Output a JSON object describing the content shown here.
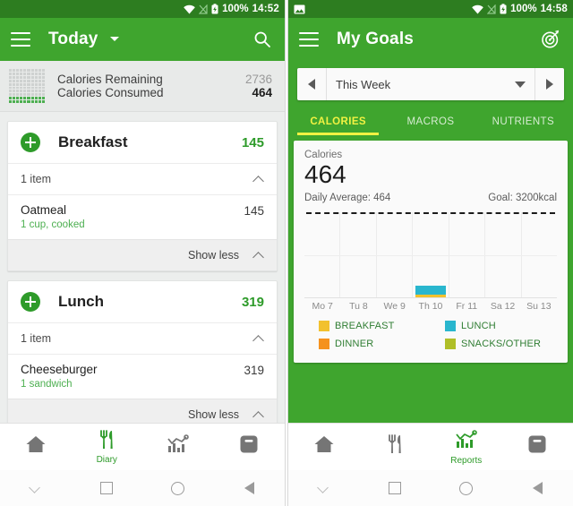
{
  "left": {
    "statusbar": {
      "wifi_icon": "wifi-icon",
      "signal_icon": "signal-off-icon",
      "battery_icon": "battery-charging-icon",
      "battery": "100%",
      "time": "14:52"
    },
    "appbar": {
      "menu_icon": "hamburger-icon",
      "title": "Today",
      "dropdown_icon": "caret-down-icon",
      "action_icon": "search-icon"
    },
    "summary": {
      "progress_icon": "calorie-dot-grid-icon",
      "remaining_label": "Calories Remaining",
      "remaining_value": "2736",
      "consumed_label": "Calories Consumed",
      "consumed_value": "464",
      "progress_percent": 15
    },
    "meals": [
      {
        "add_icon": "plus-circle-icon",
        "name": "Breakfast",
        "calories": "145",
        "item_count": "1 item",
        "collapse_icon": "chevron-up-icon",
        "foods": [
          {
            "name": "Oatmeal",
            "serving": "1  cup, cooked",
            "calories": "145"
          }
        ],
        "show_less_label": "Show less",
        "show_less_icon": "chevron-up-icon"
      },
      {
        "add_icon": "plus-circle-icon",
        "name": "Lunch",
        "calories": "319",
        "item_count": "1 item",
        "collapse_icon": "chevron-up-icon",
        "foods": [
          {
            "name": "Cheeseburger",
            "serving": "1  sandwich",
            "calories": "319"
          }
        ],
        "show_less_label": "Show less",
        "show_less_icon": "chevron-up-icon"
      }
    ],
    "bottomnav": [
      {
        "icon": "home-icon",
        "label": "",
        "active": false
      },
      {
        "icon": "cutlery-icon",
        "label": "Diary",
        "active": true
      },
      {
        "icon": "reports-chart-icon",
        "label": "",
        "active": false
      },
      {
        "icon": "scale-icon",
        "label": "",
        "active": false
      }
    ],
    "navbar": [
      {
        "icon": "collapse-chevron-icon"
      },
      {
        "icon": "recents-square-icon"
      },
      {
        "icon": "home-circle-icon"
      },
      {
        "icon": "back-triangle-icon"
      }
    ]
  },
  "right": {
    "statusbar": {
      "image_icon": "photo-icon",
      "wifi_icon": "wifi-icon",
      "signal_icon": "signal-off-icon",
      "battery_icon": "battery-charging-icon",
      "battery": "100%",
      "time": "14:58"
    },
    "appbar": {
      "menu_icon": "hamburger-icon",
      "title": "My Goals",
      "action_icon": "target-goal-icon"
    },
    "weekselector": {
      "prev_icon": "arrow-left-icon",
      "value": "This Week",
      "dropdown_icon": "caret-down-icon",
      "next_icon": "arrow-right-icon"
    },
    "tabs": [
      {
        "label": "CALORIES",
        "active": true
      },
      {
        "label": "MACROS",
        "active": false
      },
      {
        "label": "NUTRIENTS",
        "active": false
      }
    ],
    "card": {
      "title": "Calories",
      "value": "464",
      "daily_average": "Daily Average: 464",
      "goal": "Goal: 3200kcal"
    },
    "legend": [
      {
        "label": "BREAKFAST",
        "color": "#f2c12e"
      },
      {
        "label": "LUNCH",
        "color": "#29b6ce"
      },
      {
        "label": "DINNER",
        "color": "#f5921e"
      },
      {
        "label": "SNACKS/OTHER",
        "color": "#b0bf28"
      }
    ],
    "bottomnav": [
      {
        "icon": "home-icon",
        "label": "",
        "active": false
      },
      {
        "icon": "cutlery-icon",
        "label": "",
        "active": false
      },
      {
        "icon": "reports-chart-icon",
        "label": "Reports",
        "active": true
      },
      {
        "icon": "scale-icon",
        "label": "",
        "active": false
      }
    ],
    "navbar": [
      {
        "icon": "collapse-chevron-icon"
      },
      {
        "icon": "recents-square-icon"
      },
      {
        "icon": "home-circle-icon"
      },
      {
        "icon": "back-triangle-icon"
      }
    ]
  },
  "chart_data": {
    "type": "bar",
    "title": "Calories",
    "xlabel": "",
    "ylabel": "Calories",
    "categories": [
      "Mo 7",
      "Tu 8",
      "We 9",
      "Th 10",
      "Fr 11",
      "Sa 12",
      "Su 13"
    ],
    "series": [
      {
        "name": "BREAKFAST",
        "color": "#f2c12e",
        "values": [
          0,
          0,
          0,
          145,
          0,
          0,
          0
        ]
      },
      {
        "name": "LUNCH",
        "color": "#29b6ce",
        "values": [
          0,
          0,
          0,
          319,
          0,
          0,
          0
        ]
      },
      {
        "name": "DINNER",
        "color": "#f5921e",
        "values": [
          0,
          0,
          0,
          0,
          0,
          0,
          0
        ]
      },
      {
        "name": "SNACKS/OTHER",
        "color": "#b0bf28",
        "values": [
          0,
          0,
          0,
          0,
          0,
          0,
          0
        ]
      }
    ],
    "stacked": true,
    "goal_line": 3200,
    "goal_line_label": "Goal: 3200kcal",
    "daily_average": 464,
    "total": 464,
    "ylim": [
      0,
      3200
    ],
    "grid": true,
    "legend_position": "bottom"
  },
  "colors": {
    "appbar_green": "#3fa52e",
    "statusbar_green": "#2d7d20",
    "accent_green": "#2e9b2a",
    "tab_active_yellow": "#f2f242"
  }
}
